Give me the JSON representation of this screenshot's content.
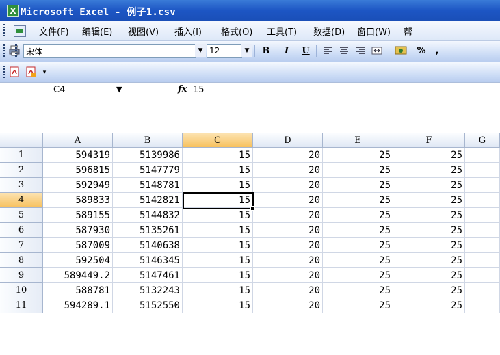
{
  "window": {
    "title": "Microsoft Excel - 例子1.csv",
    "app_icon": "excel-icon"
  },
  "menu": {
    "items": [
      "文件(F)",
      "编辑(E)",
      "视图(V)",
      "插入(I)",
      "格式(O)",
      "工具(T)",
      "数据(D)",
      "窗口(W)",
      "帮"
    ]
  },
  "toolbar": {
    "font": "宋体",
    "size": "12",
    "bold": "B",
    "italic": "I",
    "underline": "U",
    "percent": "%",
    "comma": ","
  },
  "formula_bar": {
    "name_box": "C4",
    "fx": "fx",
    "value": "15"
  },
  "sheet": {
    "columns": [
      "A",
      "B",
      "C",
      "D",
      "E",
      "F",
      "G"
    ],
    "selected_column": "C",
    "selected_row": "4",
    "rows": [
      {
        "n": "1",
        "cells": [
          "594319",
          "5139986",
          "15",
          "20",
          "25",
          "25"
        ]
      },
      {
        "n": "2",
        "cells": [
          "596815",
          "5147779",
          "15",
          "20",
          "25",
          "25"
        ]
      },
      {
        "n": "3",
        "cells": [
          "592949",
          "5148781",
          "15",
          "20",
          "25",
          "25"
        ]
      },
      {
        "n": "4",
        "cells": [
          "589833",
          "5142821",
          "15",
          "20",
          "25",
          "25"
        ]
      },
      {
        "n": "5",
        "cells": [
          "589155",
          "5144832",
          "15",
          "20",
          "25",
          "25"
        ]
      },
      {
        "n": "6",
        "cells": [
          "587930",
          "5135261",
          "15",
          "20",
          "25",
          "25"
        ]
      },
      {
        "n": "7",
        "cells": [
          "587009",
          "5140638",
          "15",
          "20",
          "25",
          "25"
        ]
      },
      {
        "n": "8",
        "cells": [
          "592504",
          "5146345",
          "15",
          "20",
          "25",
          "25"
        ]
      },
      {
        "n": "9",
        "cells": [
          "589449.2",
          "5147461",
          "15",
          "20",
          "25",
          "25"
        ]
      },
      {
        "n": "10",
        "cells": [
          "588781",
          "5132243",
          "15",
          "20",
          "25",
          "25"
        ]
      },
      {
        "n": "11",
        "cells": [
          "594289.1",
          "5152550",
          "15",
          "20",
          "25",
          "25"
        ]
      }
    ]
  }
}
